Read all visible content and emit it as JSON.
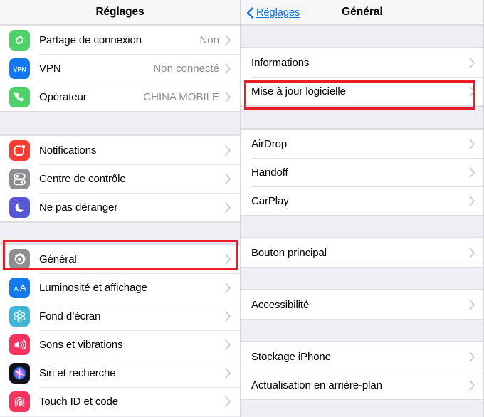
{
  "left_panel": {
    "title": "Réglages",
    "groups": [
      {
        "rows": [
          {
            "label": "Partage de connexion",
            "value": "Non",
            "icon": "personal-hotspot-icon"
          },
          {
            "label": "VPN",
            "value": "Non connecté",
            "icon": "vpn-icon"
          },
          {
            "label": "Opérateur",
            "value": "CHINA MOBILE",
            "icon": "carrier-phone-icon"
          }
        ]
      },
      {
        "rows": [
          {
            "label": "Notifications",
            "value": "",
            "icon": "notifications-icon"
          },
          {
            "label": "Centre de contrôle",
            "value": "",
            "icon": "control-center-icon"
          },
          {
            "label": "Ne pas déranger",
            "value": "",
            "icon": "do-not-disturb-moon-icon"
          }
        ]
      },
      {
        "rows": [
          {
            "label": "Général",
            "value": "",
            "icon": "general-gear-icon"
          },
          {
            "label": "Luminosité et affichage",
            "value": "",
            "icon": "display-brightness-icon"
          },
          {
            "label": "Fond d’écran",
            "value": "",
            "icon": "wallpaper-icon"
          },
          {
            "label": "Sons et vibrations",
            "value": "",
            "icon": "sounds-speaker-icon"
          },
          {
            "label": "Siri et recherche",
            "value": "",
            "icon": "siri-icon"
          },
          {
            "label": "Touch ID et code",
            "value": "",
            "icon": "touch-id-fingerprint-icon"
          }
        ]
      }
    ]
  },
  "right_panel": {
    "back_label": "Réglages",
    "title": "Général",
    "groups": [
      {
        "rows": [
          {
            "label": "Informations"
          },
          {
            "label": "Mise à jour logicielle"
          }
        ]
      },
      {
        "rows": [
          {
            "label": "AirDrop"
          },
          {
            "label": "Handoff"
          },
          {
            "label": "CarPlay"
          }
        ]
      },
      {
        "rows": [
          {
            "label": "Bouton principal"
          }
        ]
      },
      {
        "rows": [
          {
            "label": "Accessibilité"
          }
        ]
      },
      {
        "rows": [
          {
            "label": "Stockage iPhone"
          },
          {
            "label": "Actualisation en arrière-plan"
          }
        ]
      }
    ]
  },
  "highlights": {
    "color": "#ec1c24",
    "items": [
      "Général",
      "Mise à jour logicielle"
    ]
  },
  "colors": {
    "accent_blue": "#0a72ef",
    "group_background": "#ffffff",
    "page_background": "#eeeef4",
    "separator": "#e2e2e6",
    "secondary_text": "#8e8e93"
  }
}
